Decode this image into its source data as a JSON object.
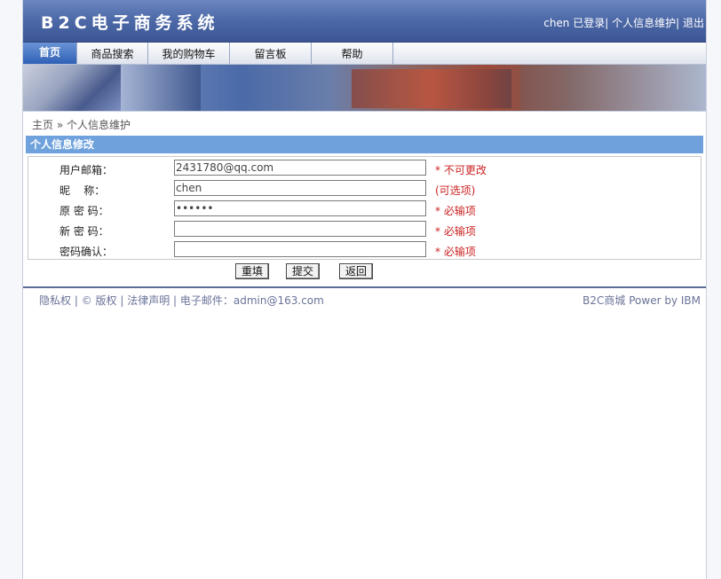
{
  "header": {
    "site_title": "B2C电子商务系统",
    "user_name": "chen",
    "logged_in_text": " 已登录",
    "sep1": "|",
    "profile_link": " 个人信息维护",
    "sep2": "|",
    "logout_link": " 退出"
  },
  "nav": {
    "items": [
      {
        "label": "首页"
      },
      {
        "label": "商品搜索"
      },
      {
        "label": "我的购物车"
      },
      {
        "label": "留言板"
      },
      {
        "label": "帮助"
      }
    ]
  },
  "breadcrumb": {
    "home": "主页",
    "separator": " » ",
    "current": "个人信息维护"
  },
  "section": {
    "title": "个人信息修改"
  },
  "form": {
    "email_label": "用户邮箱：",
    "email_value": "2431780@qq.com",
    "email_hint": "* 不可更改",
    "nickname_label": "昵    称：",
    "nickname_value": "chen",
    "nickname_hint": " (可选项)",
    "old_password_label": "原 密 码：",
    "old_password_value": "••••••",
    "old_password_hint": "* 必输项",
    "new_password_label": "新 密 码：",
    "new_password_value": "",
    "new_password_hint": "* 必输项",
    "confirm_label": "密码确认：",
    "confirm_value": "",
    "confirm_hint": "* 必输项"
  },
  "buttons": {
    "reset": "重填",
    "submit": "提交",
    "back": "返回"
  },
  "footer": {
    "privacy": "隐私权",
    "sep_a": " | ",
    "copyright": "© 版权",
    "sep_b": " | ",
    "legal": "法律声明",
    "sep_c": " | ",
    "email": "电子邮件：admin@163.com",
    "brand": "B2C商城  Power by IBM"
  }
}
